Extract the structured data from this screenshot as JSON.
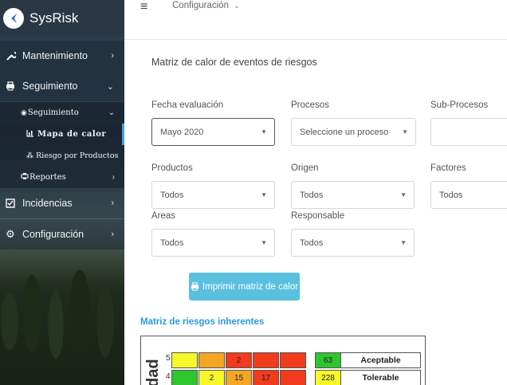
{
  "app": {
    "name": "SysRisk"
  },
  "sidebar": {
    "items": [
      {
        "label": "Mantenimiento",
        "icon": "wrench-icon"
      },
      {
        "label": "Seguimiento",
        "icon": "printer-icon"
      },
      {
        "label": "Incidencias",
        "icon": "checkbox-icon"
      },
      {
        "label": "Configuración",
        "icon": "gears-icon"
      }
    ],
    "subitems": [
      {
        "label": "Seguimiento",
        "icon": "eye-icon"
      },
      {
        "label": "Mapa de calor",
        "icon": "bar-chart-icon"
      },
      {
        "label": "Riesgo por Productos",
        "icon": "sitemap-icon"
      },
      {
        "label": "Reportes",
        "icon": "print-icon"
      }
    ]
  },
  "topbar": {
    "breadcrumb": "Configuración",
    "breadcrumb_caret": "⌄"
  },
  "page": {
    "title": "Matriz de calor de eventos de riesgos"
  },
  "filters": {
    "fecha": {
      "label": "Fecha evaluación",
      "value": "Mayo 2020"
    },
    "procesos": {
      "label": "Procesos",
      "value": "Seleccione un proceso"
    },
    "subprocesos": {
      "label": "Sub-Procesos",
      "value": ""
    },
    "productos": {
      "label": "Productos",
      "value": "Todos"
    },
    "origen": {
      "label": "Origen",
      "value": "Todos"
    },
    "factores": {
      "label": "Factores",
      "value": "Todos"
    },
    "areas": {
      "label": "Areas",
      "value": "Todos"
    },
    "responsable": {
      "label": "Responsable",
      "value": "Todos"
    }
  },
  "print_button": {
    "label": "Imprimir matriz de calor"
  },
  "matrix": {
    "section_title": "Matriz de riesgos inherentes",
    "axis_label": "dad",
    "rows": [
      {
        "num": "5",
        "cells": [
          "",
          "",
          "2",
          "",
          ""
        ]
      },
      {
        "num": "4",
        "cells": [
          "",
          "2",
          "15",
          "17",
          ""
        ]
      }
    ],
    "legend": [
      {
        "count": "63",
        "label": "Aceptable",
        "color": "#2ec52e"
      },
      {
        "count": "228",
        "label": "Tolerable",
        "color": "#f7f72a"
      }
    ],
    "colors": {
      "green": "#2ec52e",
      "yellow": "#f7f72a",
      "orange": "#f5a623",
      "red": "#f23a1c"
    }
  }
}
